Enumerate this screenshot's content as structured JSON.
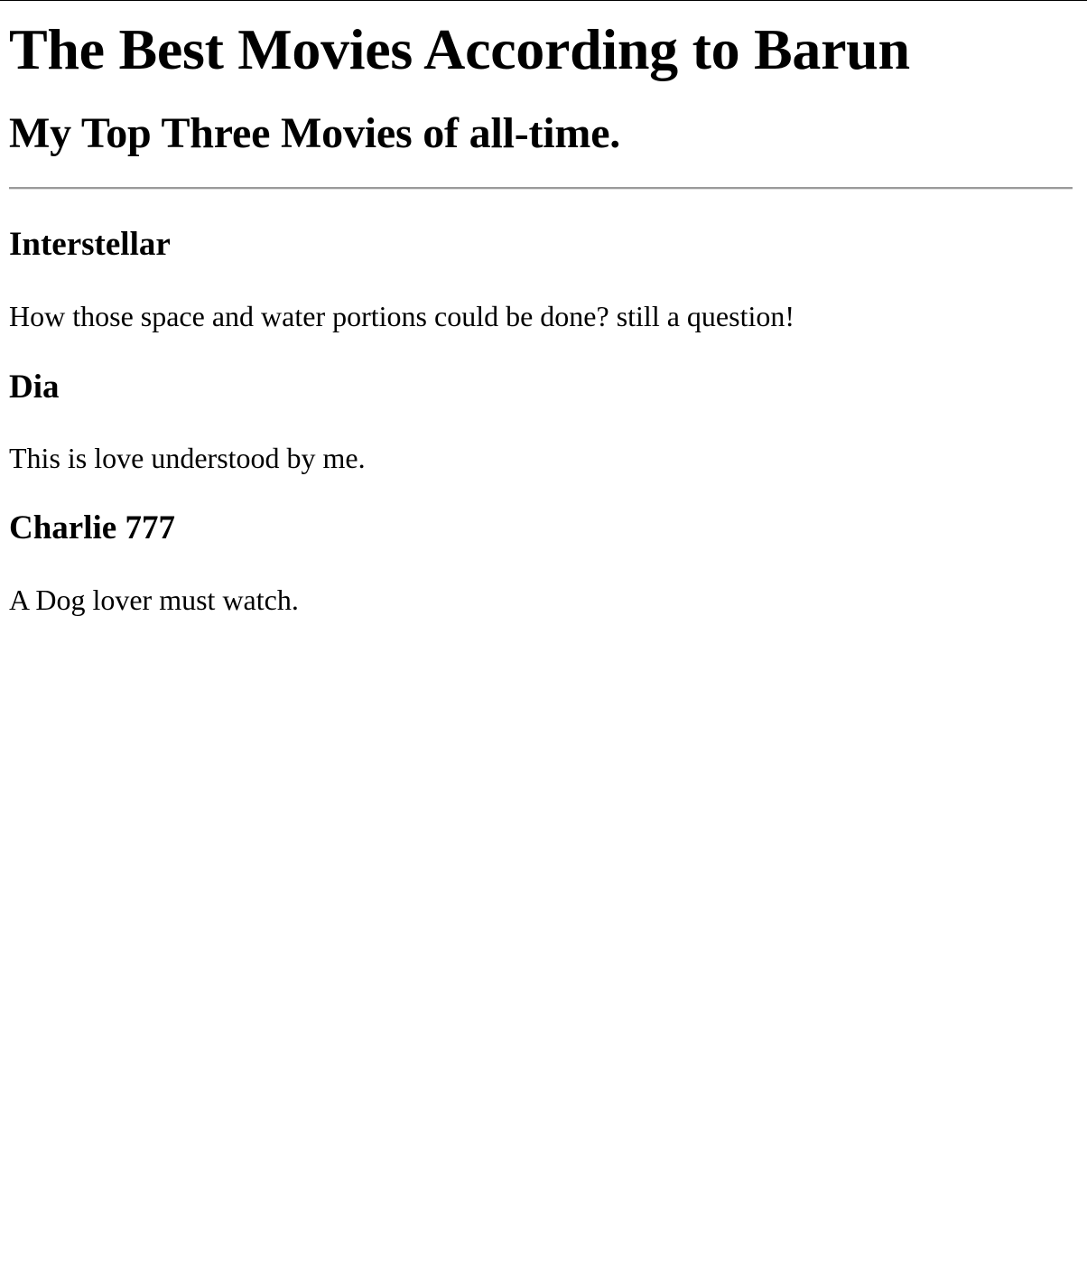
{
  "header": {
    "title": "The Best Movies According to Barun",
    "subtitle": "My Top Three Movies of all-time."
  },
  "movies": [
    {
      "title": "Interstellar",
      "description": "How those space and water portions could be done? still a question!"
    },
    {
      "title": "Dia",
      "description": "This is love understood by me."
    },
    {
      "title": "Charlie 777",
      "description": "A Dog lover must watch."
    }
  ]
}
